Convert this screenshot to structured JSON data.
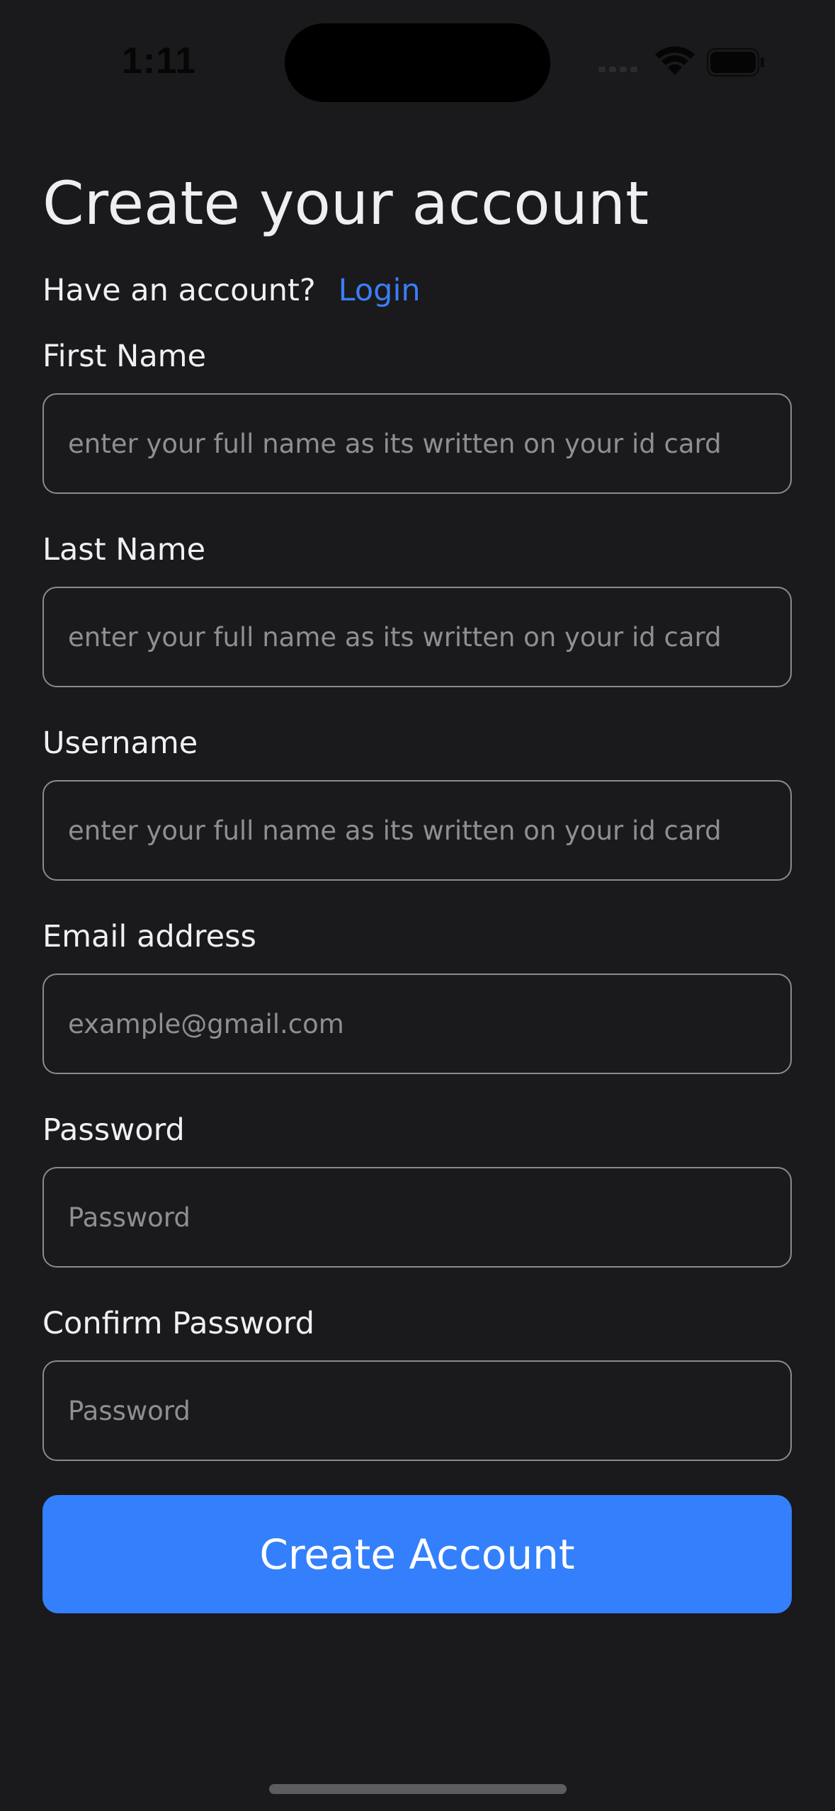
{
  "status_bar": {
    "time": "1:11"
  },
  "header": {
    "title": "Create your account",
    "login_prompt": "Have an account?",
    "login_link": "Login"
  },
  "fields": [
    {
      "label": "First Name",
      "placeholder": "enter your full name as its written on your id card"
    },
    {
      "label": "Last Name",
      "placeholder": "enter your full name as its written on your id card"
    },
    {
      "label": "Username",
      "placeholder": "enter your full name as its written on your id card"
    },
    {
      "label": "Email address",
      "placeholder": "example@gmail.com"
    },
    {
      "label": "Password",
      "placeholder": "Password"
    },
    {
      "label": "Confirm Password",
      "placeholder": "Password"
    }
  ],
  "submit": {
    "label": "Create Account"
  },
  "colors": {
    "background": "#1a191b",
    "accent": "#347ffc",
    "link": "#3a7ef6",
    "field_border": "#8b8a8e",
    "placeholder": "#8f8e92"
  }
}
